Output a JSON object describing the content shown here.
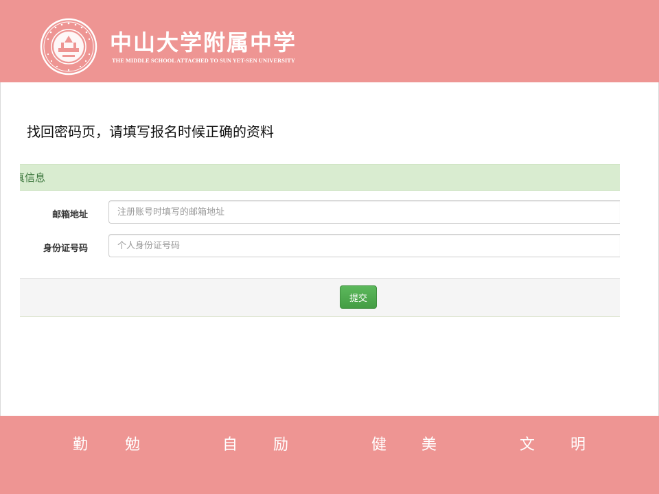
{
  "header": {
    "logo_cn": "中山大学附属中学",
    "logo_en": "THE MIDDLE SCHOOL ATTACHED TO  SUN YET-SEN UNIVERSITY",
    "seal_icon": "school-seal-icon"
  },
  "main": {
    "heading": "找回密码页，请填写报名时候正确的资料",
    "panel_title": "真信息",
    "fields": [
      {
        "label": "邮箱地址",
        "placeholder": "注册账号时填写的邮箱地址",
        "value": ""
      },
      {
        "label": "身份证号码",
        "placeholder": "个人身份证号码",
        "value": ""
      }
    ],
    "submit_label": "提交"
  },
  "footer": {
    "motto": [
      "勤",
      "勉",
      "自",
      "励",
      "健",
      "美",
      "文",
      "明"
    ]
  },
  "colors": {
    "brand": "#ee9593",
    "panel_heading_bg": "#d9ecd0",
    "panel_heading_text": "#3c763d",
    "success_button": "#5cb85c"
  }
}
